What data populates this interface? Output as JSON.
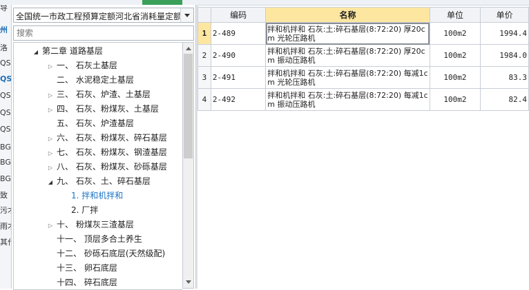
{
  "left_strip": {
    "fragments": [
      {
        "text": "导",
        "color": "normal"
      },
      {
        "text": "州",
        "color": "blue"
      },
      {
        "text": "洛",
        "color": "normal"
      },
      {
        "text": "QS(",
        "color": "normal"
      },
      {
        "text": "QS",
        "color": "blue"
      },
      {
        "text": "QS(",
        "color": "normal"
      },
      {
        "text": "QS(",
        "color": "normal"
      },
      {
        "text": "QS(",
        "color": "normal"
      },
      {
        "text": "BG(",
        "color": "normal"
      },
      {
        "text": "BG(",
        "color": "normal"
      },
      {
        "text": "BG(",
        "color": "normal"
      },
      {
        "text": "致",
        "color": "normal"
      },
      {
        "text": "污才",
        "color": "normal"
      },
      {
        "text": "雨才",
        "color": "normal"
      },
      {
        "text": "其代",
        "color": "normal"
      }
    ]
  },
  "library_select": {
    "value": "全国统一市政工程预算定额河北省消耗量定额"
  },
  "search": {
    "placeholder": "搜索"
  },
  "tree": [
    {
      "label": "第二章  道路基层",
      "toggle": "open",
      "indent": 0,
      "selected": false
    },
    {
      "label": "一、  石灰土基层",
      "toggle": "closed",
      "indent": 1,
      "selected": false
    },
    {
      "label": "二、  水泥稳定土基层",
      "toggle": "none",
      "indent": 1,
      "selected": false
    },
    {
      "label": "三、  石灰、炉渣、土基层",
      "toggle": "closed",
      "indent": 1,
      "selected": false
    },
    {
      "label": "四、  石灰、粉煤灰、土基层",
      "toggle": "closed",
      "indent": 1,
      "selected": false
    },
    {
      "label": "五、  石灰、炉渣基层",
      "toggle": "none",
      "indent": 1,
      "selected": false
    },
    {
      "label": "六、  石灰、粉煤灰、碎石基层",
      "toggle": "closed",
      "indent": 1,
      "selected": false
    },
    {
      "label": "七、  石灰、粉煤灰、钢渣基层",
      "toggle": "closed",
      "indent": 1,
      "selected": false
    },
    {
      "label": "八、  石灰、粉煤灰、砂砾基层",
      "toggle": "closed",
      "indent": 1,
      "selected": false
    },
    {
      "label": "九、  石灰、土、碎石基层",
      "toggle": "open",
      "indent": 1,
      "selected": false
    },
    {
      "label": "1.  拌和机拌和",
      "toggle": "none",
      "indent": 2,
      "selected": true
    },
    {
      "label": "2.  厂拌",
      "toggle": "none",
      "indent": 2,
      "selected": false
    },
    {
      "label": "十、  粉煤灰三渣基层",
      "toggle": "closed",
      "indent": 1,
      "selected": false
    },
    {
      "label": "十一、  顶层多合土养生",
      "toggle": "none",
      "indent": 1,
      "selected": false
    },
    {
      "label": "十二、  砂砾石底层(天然级配)",
      "toggle": "none",
      "indent": 1,
      "selected": false
    },
    {
      "label": "十三、  卵石底层",
      "toggle": "none",
      "indent": 1,
      "selected": false
    },
    {
      "label": "十四、  碎石底层",
      "toggle": "none",
      "indent": 1,
      "selected": false
    }
  ],
  "grid": {
    "columns": {
      "code": "编码",
      "name": "名称",
      "unit": "单位",
      "price": "单价"
    },
    "rows": [
      {
        "num": "1",
        "code": "2-489",
        "name": "拌和机拌和 石灰:土:碎石基层(8:72:20) 厚20cm 光轮压路机",
        "unit": "100m2",
        "price": "1994.4"
      },
      {
        "num": "2",
        "code": "2-490",
        "name": "拌和机拌和 石灰:土:碎石基层(8:72:20) 厚20cm 振动压路机",
        "unit": "100m2",
        "price": "1984.0"
      },
      {
        "num": "3",
        "code": "2-491",
        "name": "拌和机拌和 石灰:土:碎石基层(8:72:20) 每减1cm 光轮压路机",
        "unit": "100m2",
        "price": "83.3"
      },
      {
        "num": "4",
        "code": "2-492",
        "name": "拌和机拌和 石灰:土:碎石基层(8:72:20) 每减1cm 振动压路机",
        "unit": "100m2",
        "price": "82.4"
      }
    ]
  }
}
